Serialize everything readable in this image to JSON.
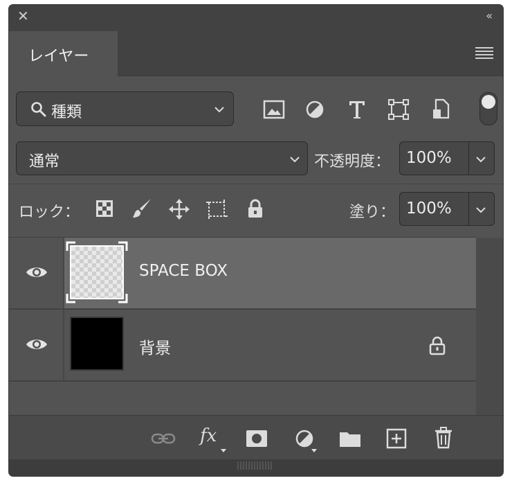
{
  "panel": {
    "tab_label": "レイヤー"
  },
  "filter": {
    "kind_label": "種類",
    "toggle_on": true
  },
  "blend": {
    "mode": "通常",
    "opacity_label": "不透明度：",
    "opacity_value": "100%"
  },
  "lock": {
    "label": "ロック：",
    "fill_label": "塗り：",
    "fill_value": "100%"
  },
  "layers": [
    {
      "name": "SPACE BOX",
      "visible": true,
      "selected": true,
      "locked": false
    },
    {
      "name": "背景",
      "visible": true,
      "selected": false,
      "locked": true
    }
  ],
  "footer_icons": [
    "link-icon",
    "fx-icon",
    "mask-icon",
    "adjustment-icon",
    "folder-icon",
    "new-layer-icon",
    "trash-icon"
  ]
}
